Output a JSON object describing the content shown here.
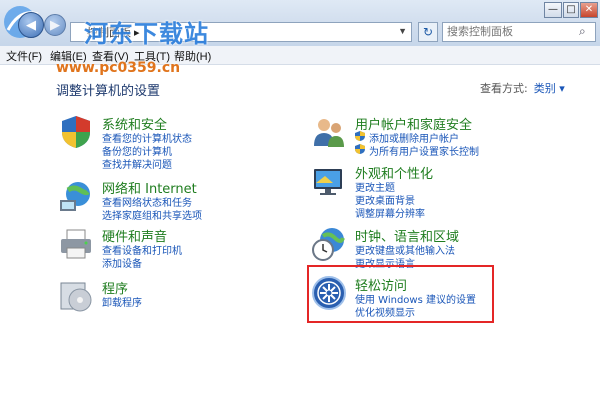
{
  "address": {
    "crumb": "控制面板 ▸"
  },
  "search": {
    "placeholder": "搜索控制面板"
  },
  "window_controls": [
    "—",
    "□",
    "✕"
  ],
  "menu": [
    "文件(F)",
    "编辑(E)",
    "查看(V)",
    "工具(T)",
    "帮助(H)"
  ],
  "watermark": {
    "title": "河东下载站",
    "url": "www.pc0359.cn"
  },
  "page_title": "调整计算机的设置",
  "view_by": {
    "label": "查看方式:",
    "value": "类别 ▾"
  },
  "categories": [
    {
      "title": "系统和安全",
      "icon": "shield-flag-icon",
      "links": [
        "查看您的计算机状态",
        "备份您的计算机",
        "查找并解决问题"
      ]
    },
    {
      "title": "网络和 Internet",
      "icon": "network-globe-icon",
      "links": [
        "查看网络状态和任务",
        "选择家庭组和共享选项"
      ]
    },
    {
      "title": "硬件和声音",
      "icon": "printer-icon",
      "links": [
        "查看设备和打印机",
        "添加设备"
      ]
    },
    {
      "title": "程序",
      "icon": "programs-icon",
      "links": [
        "卸载程序"
      ]
    },
    {
      "title": "用户帐户和家庭安全",
      "icon": "users-icon",
      "links": [
        "添加或删除用户帐户",
        "为所有用户设置家长控制"
      ]
    },
    {
      "title": "外观和个性化",
      "icon": "monitor-icon",
      "links": [
        "更改主题",
        "更改桌面背景",
        "调整屏幕分辨率"
      ]
    },
    {
      "title": "时钟、语言和区域",
      "icon": "clock-globe-icon",
      "links": [
        "更改键盘或其他输入法",
        "更改显示语言"
      ]
    },
    {
      "title": "轻松访问",
      "icon": "ease-of-access-icon",
      "links": [
        "使用 Windows 建议的设置",
        "优化视频显示"
      ]
    }
  ],
  "colors": {
    "category_title": "#1f7d1f",
    "link": "#1a56b8",
    "highlight": "#e42626",
    "watermark_blue": "#2d7fdc",
    "watermark_orange": "#e0741c"
  }
}
